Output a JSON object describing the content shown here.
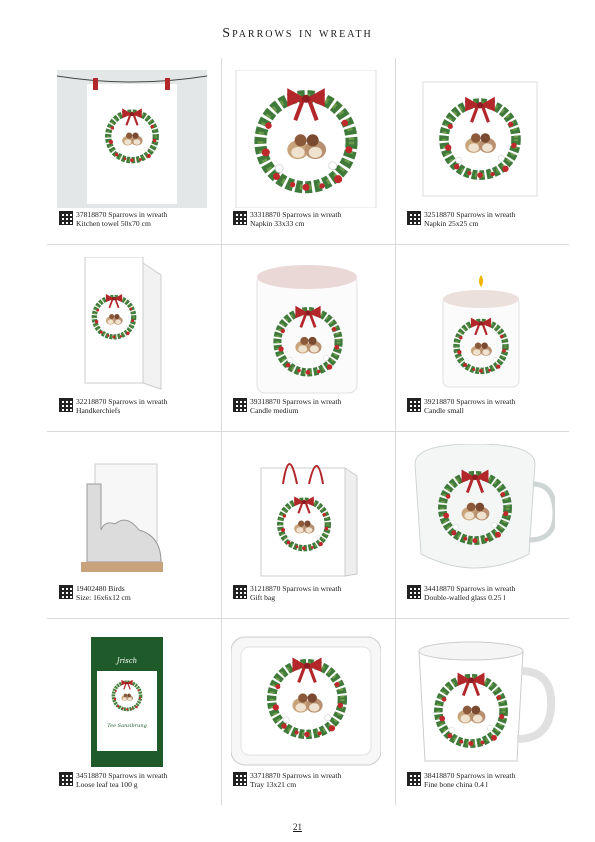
{
  "page": {
    "title": "Sparrows in wreath",
    "page_number": "21"
  },
  "products": [
    {
      "line1": "37818870 Sparrows in wreath",
      "line2": "Kitchen towel 50x70 cm",
      "kind": "towel"
    },
    {
      "line1": "33318870 Sparrows in wreath",
      "line2": "Napkin 33x33 cm",
      "kind": "napkin-large"
    },
    {
      "line1": "32518870 Sparrows in wreath",
      "line2": "Napkin 25x25 cm",
      "kind": "napkin-small"
    },
    {
      "line1": "32218870 Sparrows in wreath",
      "line2": "Handkerchiefs",
      "kind": "handkerchiefs"
    },
    {
      "line1": "39318870 Sparrows in wreath",
      "line2": "Candle medium",
      "kind": "candle-medium"
    },
    {
      "line1": "39218870 Sparrows in wreath",
      "line2": "Candle small",
      "kind": "candle-small"
    },
    {
      "line1": "19402480 Birds",
      "line2": "Size: 16x6x12 cm",
      "kind": "napkin-holder"
    },
    {
      "line1": "31218870 Sparrows in wreath",
      "line2": "Gift bag",
      "kind": "gift-bag"
    },
    {
      "line1": "34418870 Sparrows in wreath",
      "line2": "Double-walled glass 0.25 l",
      "kind": "glass"
    },
    {
      "line1": "34518870 Sparrows in wreath",
      "line2": "Loose leaf tea 100 g",
      "kind": "tea"
    },
    {
      "line1": "33718870 Sparrows in wreath",
      "line2": "Tray 13x21 cm",
      "kind": "tray"
    },
    {
      "line1": "38418870 Sparrows in wreath",
      "line2": "Fine bone china 0.4 l",
      "kind": "mug"
    }
  ],
  "tea_label": {
    "brand": "Jrisch",
    "product": "Tee Sanzibrung"
  },
  "colors": {
    "wreath_green": "#3f7a3a",
    "bow_red": "#b3262a",
    "berry_red": "#c0282b",
    "tea_bag_green": "#1f5a2a",
    "divider": "#d9d9d9"
  }
}
